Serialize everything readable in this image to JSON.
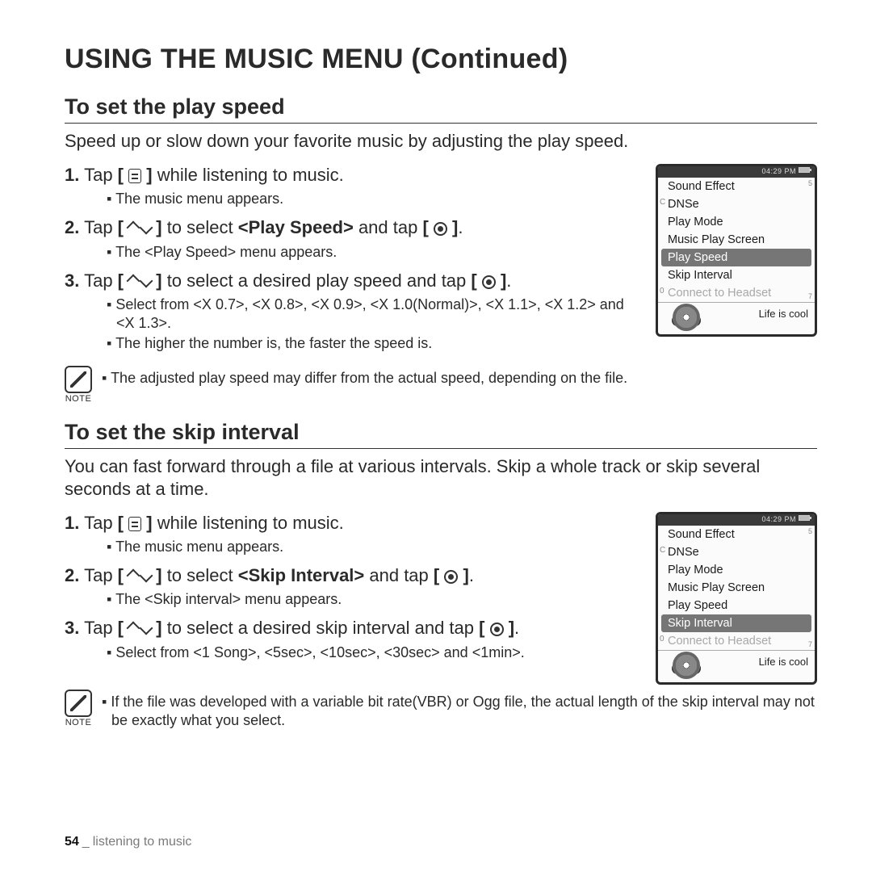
{
  "page_title": "USING THE MUSIC MENU (Continued)",
  "section1": {
    "heading": "To set the play speed",
    "intro": "Speed up or slow down your favorite music by adjusting the play speed.",
    "step1_a": "Tap ",
    "step1_b": " while listening to music.",
    "step1_sub": "The music menu appears.",
    "step2_a": "Tap ",
    "step2_b": " to select ",
    "step2_bold": "<Play Speed>",
    "step2_c": " and tap ",
    "step2_sub": "The <Play Speed> menu appears.",
    "step3_a": "Tap ",
    "step3_b": " to select a desired play speed and tap ",
    "step3_sub1": "Select from <X 0.7>, <X 0.8>, <X 0.9>, <X 1.0(Normal)>, <X 1.1>, <X 1.2> and <X 1.3>.",
    "step3_sub2": "The higher the number is, the faster the speed is.",
    "note": "The adjusted play speed may differ from the actual speed, depending on the file."
  },
  "section2": {
    "heading": "To set the skip interval",
    "intro": "You can fast forward through a file at various intervals. Skip a whole track or skip several seconds at a time.",
    "step1_a": "Tap ",
    "step1_b": " while listening to music.",
    "step1_sub": "The music menu appears.",
    "step2_a": "Tap ",
    "step2_b": " to select ",
    "step2_bold": "<Skip Interval>",
    "step2_c": " and tap ",
    "step2_sub": "The <Skip interval> menu appears.",
    "step3_a": "Tap ",
    "step3_b": " to select a desired skip interval and tap ",
    "step3_sub1": "Select from <1 Song>, <5sec>, <10sec>, <30sec> and <1min>.",
    "note": "If the file was developed with a variable bit rate(VBR) or Ogg file, the actual length of the skip interval may not be exactly what you select."
  },
  "device1": {
    "time": "04:29 PM",
    "items": [
      "Sound Effect",
      "DNSe",
      "Play Mode",
      "Music Play Screen",
      "Play Speed",
      "Skip Interval",
      "Connect to Headset"
    ],
    "selected_index": 4,
    "disabled_index": 6,
    "track": "Life is cool",
    "side_top": "5",
    "side_bot": "7",
    "left_c": "C",
    "left_0": "0"
  },
  "device2": {
    "time": "04:29 PM",
    "items": [
      "Sound Effect",
      "DNSe",
      "Play Mode",
      "Music Play Screen",
      "Play Speed",
      "Skip Interval",
      "Connect to Headset"
    ],
    "selected_index": 5,
    "disabled_index": 6,
    "track": "Life is cool",
    "side_top": "5",
    "side_bot": "7",
    "left_c": "C",
    "left_0": "0"
  },
  "note_label": "NOTE",
  "footer": {
    "page": "54",
    "crumb": "listening to music"
  }
}
